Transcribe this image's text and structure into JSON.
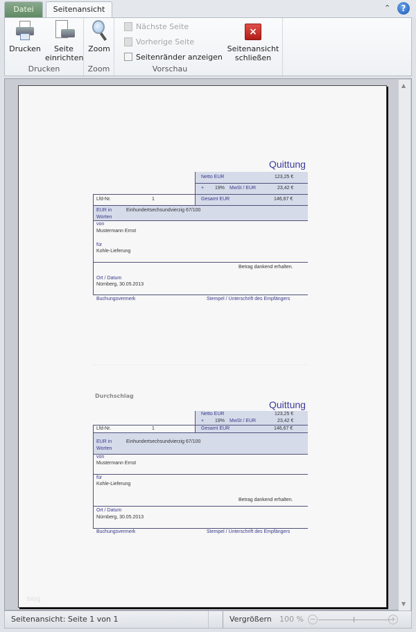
{
  "tabs": {
    "file": "Datei",
    "active": "Seitenansicht"
  },
  "ribbon": {
    "print": "Drucken",
    "page_setup_1": "Seite",
    "page_setup_2": "einrichten",
    "zoom": "Zoom",
    "next_page": "Nächste Seite",
    "prev_page": "Vorherige Seite",
    "show_margins": "Seitenränder anzeigen",
    "close_1": "Seitenansicht",
    "close_2": "schließen",
    "groups": {
      "print": "Drucken",
      "zoom": "Zoom",
      "preview": "Vorschau"
    }
  },
  "receipt": {
    "title": "Quittung",
    "netto_label": "Netto EUR",
    "netto_value": "123,25 €",
    "vat_plus": "+",
    "vat_rate": "19%",
    "vat_label": "MwSt / EUR",
    "vat_value": "23,42 €",
    "total_label": "Gesamt EUR",
    "total_value": "146,67 €",
    "nr_label": "Lfd-Nr.",
    "nr_value": "1",
    "words_label_1": "EUR in",
    "words_label_2": "Worten",
    "words_value": "Einhundertsechsundvierzig 67/100",
    "from_label": "von",
    "from_value": "Mustermann Ernst",
    "for_label": "für",
    "for_value": "Kohle-Lieferung",
    "received": "Betrag dankend erhalten.",
    "place_label": "Ort / Datum",
    "place_value": "Nürnberg, 30.05.2013",
    "booking": "Buchungsvermerk",
    "signature": "Stempel / Unterschrift des Empfängers"
  },
  "copy_label": "Durchschlag",
  "watermark": "blog",
  "status": {
    "page": "Seitenansicht: Seite 1 von 1",
    "zoom_label": "Vergrößern",
    "zoom_value": "100 %"
  },
  "zoom_percent": 100
}
